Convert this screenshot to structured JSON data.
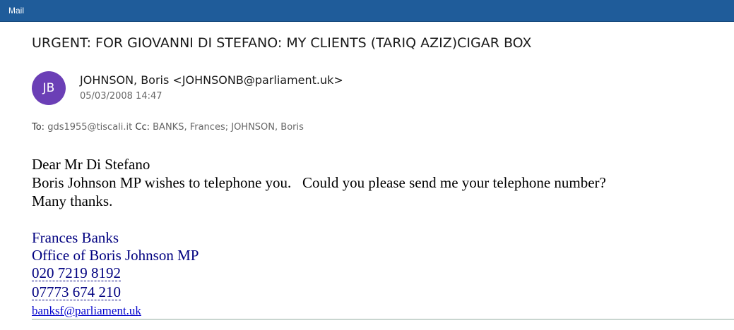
{
  "titlebar": {
    "app_title": "Mail"
  },
  "message": {
    "subject": "URGENT: FOR GIOVANNI DI STEFANO: MY CLIENTS (TARIQ AZIZ)CIGAR BOX",
    "avatar_initials": "JB",
    "avatar_color": "#6b3fb6",
    "sender": "JOHNSON, Boris <JOHNSONB@parliament.uk>",
    "date": "05/03/2008 14:47",
    "to_label": "To:",
    "to": "gds1955@tiscali.it",
    "cc_label": "Cc:",
    "cc": "BANKS, Frances; JOHNSON, Boris",
    "body": {
      "greeting": "Dear Mr Di Stefano",
      "line1": "Boris Johnson MP wishes to telephone you.   Could you please send me your telephone number?",
      "line2": "Many thanks."
    },
    "signature": {
      "name": "Frances Banks",
      "office": "Office of Boris Johnson MP",
      "phone1": "020 7219 8192",
      "phone2": "07773 674 210",
      "email": "banksf@parliament.uk"
    }
  },
  "colors": {
    "titlebar": "#1f5c9a",
    "signature_text": "#000080",
    "link": "#0000cc"
  }
}
